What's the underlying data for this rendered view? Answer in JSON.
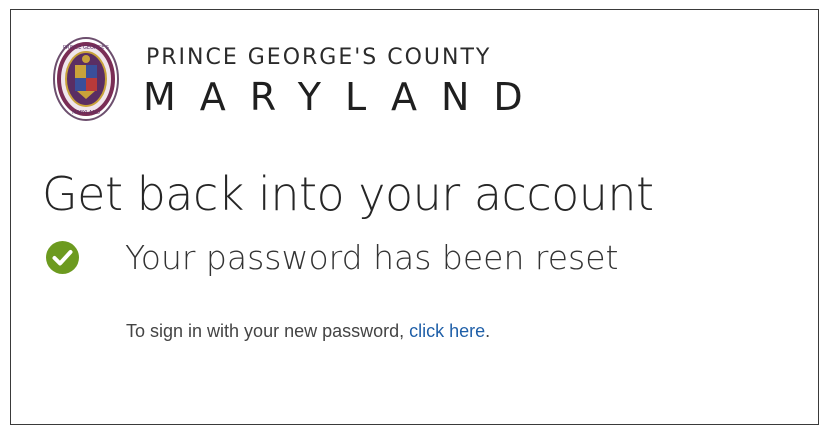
{
  "branding": {
    "seal_icon": "county-seal-icon",
    "seal_ring_text": "PRINCE GEORGE'S COUNTY MARYLAND",
    "line1": "PRINCE GEORGE'S COUNTY",
    "line2": "MARYLAND"
  },
  "page": {
    "title": "Get back into your account"
  },
  "status": {
    "icon": "check-circle-icon",
    "icon_color": "#6c9a1f",
    "message": "Your password has been reset"
  },
  "instruction": {
    "prefix": "To sign in with your new password, ",
    "link_text": "click here",
    "suffix": ".",
    "link_color": "#1f5fa8"
  }
}
